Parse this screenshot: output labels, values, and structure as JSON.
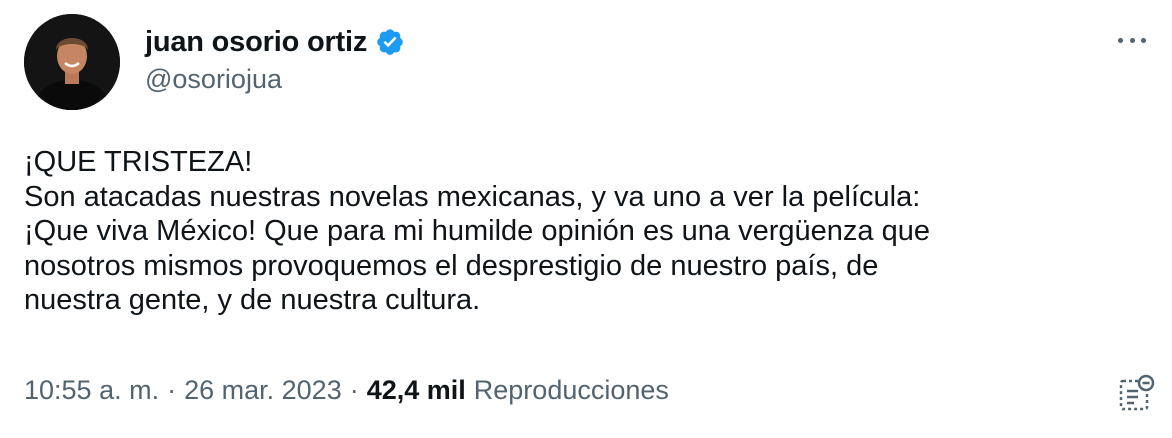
{
  "author": {
    "display_name": "juan osorio ortiz",
    "handle": "@osoriojua",
    "verified": true,
    "verified_color": "#1d9bf0"
  },
  "tweet": {
    "text": "¡QUE TRISTEZA!\nSon atacadas nuestras novelas mexicanas, y va uno a ver la película:\n¡Que viva México! Que para mi humilde opinión es una vergüenza que\nnosotros mismos provoquemos el desprestigio de nuestro país, de\nnuestra gente, y de nuestra cultura."
  },
  "meta": {
    "time": "10:55 a. m.",
    "separator": "·",
    "date": "26 mar. 2023",
    "views_count": "42,4 mil",
    "views_label": "Reproducciones"
  },
  "icons": {
    "more": "more-options-icon",
    "analytics": "analytics-icon",
    "verified": "verified-badge-icon"
  }
}
